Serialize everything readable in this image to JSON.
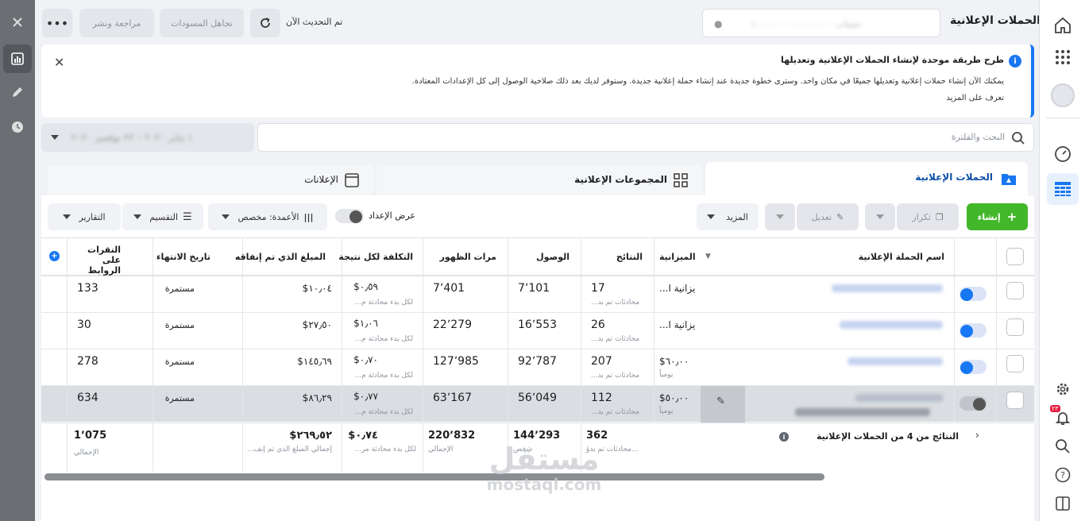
{
  "header": {
    "title": "الحملات الإعلانية",
    "account_masked": "حساب ١٠٠٠٠٠٠٠٠٠٠٠٠٠٠٠",
    "updated_label": "تم التحديث الآن",
    "discard_label": "تجاهل المسودات",
    "review_label": "مراجعة ونشر",
    "more_icon": "ellipsis-icon"
  },
  "banner": {
    "title": "طرح طريقة موحدة لإنشاء الحملات الإعلانية وتعديلها",
    "body": "يمكنك الآن إنشاء حملات إعلانية وتعديلها جميعًا في مكان واحد. وسترى خطوة جديدة عند إنشاء حملة إعلانية جديدة. وستوفر لديك بعد ذلك صلاحية الوصول إلى كل الإعدادات المعتادة.",
    "link": "تعرف على المزيد"
  },
  "search": {
    "placeholder": "البحث والفلترة",
    "date_masked": "١ يناير ٢٠٢٠ – ٢٢ نوفمبر ٢٠٢٠"
  },
  "tabs": [
    {
      "label": "الحملات الإعلانية"
    },
    {
      "label": "المجموعات الإعلانية"
    },
    {
      "label": "الإعلانات"
    }
  ],
  "toolbar": {
    "create": "إنشاء",
    "duplicate": "تكرار",
    "edit": "تعديل",
    "more": "المزيد",
    "view_setup": "عرض الإعداد",
    "columns": "الأعمدة: مخصص",
    "breakdown": "التقسيم",
    "reports": "التقارير"
  },
  "columns": [
    "اسم الحملة الإعلانية",
    "الميزانية",
    "النتائج",
    "الوصول",
    "مرات الظهور",
    "التكلفة لكل نتيجة",
    "المبلغ الذي تم إنفاقه",
    "تاريخ الانتهاء",
    "النقرات على الروابط"
  ],
  "rows": [
    {
      "budget": "يزانية ا...",
      "budget_sub": "",
      "results": "17",
      "results_sub": "محادثات تم بد...",
      "reach": "7٬101",
      "impressions": "7٬401",
      "cpr": "٠٫٥٩$",
      "cpr_sub": "لكل بدء محادثة م...",
      "spent": "١٠٫٠٤$",
      "end": "مستمرة",
      "clicks": "133",
      "on": true
    },
    {
      "budget": "يزانية ا...",
      "budget_sub": "",
      "results": "26",
      "results_sub": "محادثات تم بد...",
      "reach": "16٬553",
      "impressions": "22٬279",
      "cpr": "١٫٠٦$",
      "cpr_sub": "لكل بدء محادثة م...",
      "spent": "٢٧٫٥٠$",
      "end": "مستمرة",
      "clicks": "30",
      "on": true
    },
    {
      "budget": "٦٠٫٠٠$",
      "budget_sub": "يومياً",
      "results": "207",
      "results_sub": "محادثات تم بد...",
      "reach": "92٬787",
      "impressions": "127٬985",
      "cpr": "٠٫٧٠$",
      "cpr_sub": "لكل بدء محادثة م...",
      "spent": "١٤٥٫٦٩$",
      "end": "مستمرة",
      "clicks": "278",
      "on": true
    },
    {
      "budget": "٥٠٫٠٠$",
      "budget_sub": "يومياً",
      "results": "112",
      "results_sub": "محادثات تم بد...",
      "reach": "56٬049",
      "impressions": "63٬167",
      "cpr": "٠٫٧٧$",
      "cpr_sub": "لكل بدء محادثة م...",
      "spent": "٨٦٫٢٩$",
      "end": "مستمرة",
      "clicks": "634",
      "on": false
    }
  ],
  "totals": {
    "label": "النتائج من 4 من الحملات الإعلانية",
    "results": "362",
    "results_sub": "محادثات تم بدؤ...",
    "reach": "144٬293",
    "reach_sub": "شخص",
    "impressions": "220٬832",
    "impressions_sub": "الإجمالي",
    "cpr": "٠٫٧٤$",
    "cpr_sub": "لكل بدء محادثة مر...",
    "spent": "٢٦٩٫٥٢$",
    "spent_sub": "إجمالي المبلغ الذي تم إنف...",
    "clicks": "1٬075",
    "clicks_sub": "الإجمالي"
  },
  "watermark": {
    "logo": "مستقل",
    "url": "mostaql.com"
  },
  "nav": {
    "notif_count": "٢٣"
  },
  "colors": {
    "accent": "#1877f2",
    "green": "#42b72a",
    "blue_dark": "#0d4fa8"
  }
}
